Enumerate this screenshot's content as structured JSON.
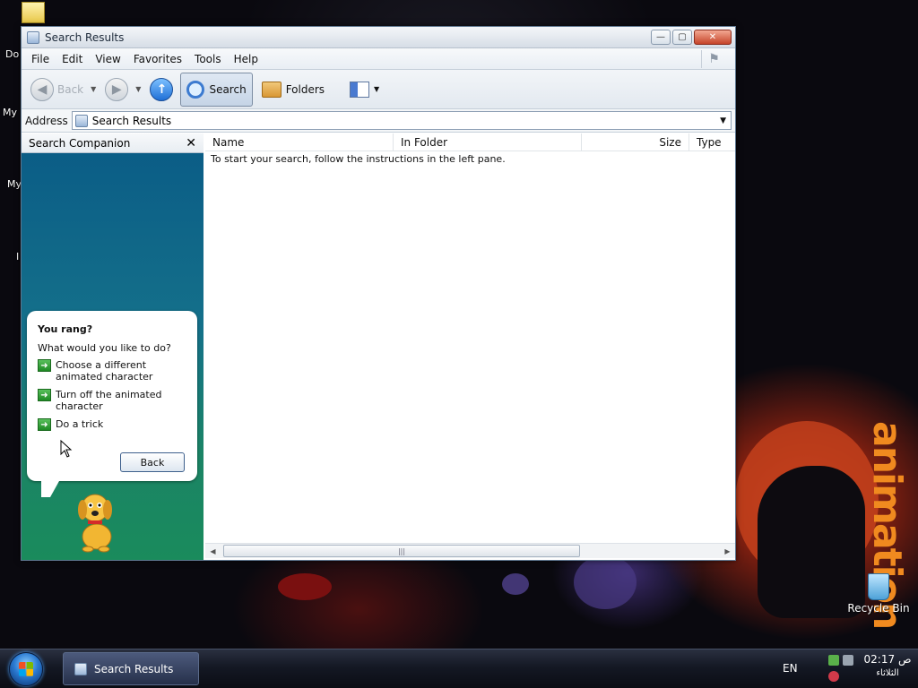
{
  "window": {
    "title": "Search Results",
    "controls": {
      "minimize": "—",
      "maximize": "▢",
      "close": "✕"
    }
  },
  "menubar": {
    "items": [
      "File",
      "Edit",
      "View",
      "Favorites",
      "Tools",
      "Help"
    ]
  },
  "toolbar": {
    "back_label": "Back",
    "search_label": "Search",
    "folders_label": "Folders"
  },
  "addressbar": {
    "label": "Address",
    "value": "Search Results"
  },
  "companion": {
    "header": "Search Companion",
    "balloon": {
      "title": "You rang?",
      "question": "What would you like to do?",
      "options": [
        "Choose a different animated character",
        "Turn off the animated character",
        "Do a trick"
      ],
      "back_label": "Back"
    }
  },
  "results": {
    "columns": [
      "Name",
      "In Folder",
      "Size",
      "Type"
    ],
    "empty_message": "To start your search, follow the instructions in the left pane."
  },
  "desktop": {
    "icons": [
      {
        "label": "Do"
      },
      {
        "label": "My"
      },
      {
        "label": "My"
      },
      {
        "label": "I"
      }
    ],
    "recycle_bin": "Recycle Bin",
    "art_text": "animation"
  },
  "taskbar": {
    "active_task": "Search Results",
    "language": "EN",
    "clock_time": "02:17 ص",
    "clock_day": "الثلاثاء"
  },
  "colors": {
    "accent": "#1f6fd6",
    "companion_top": "#0a5b86",
    "companion_bottom": "#1a8b5c",
    "art_orange": "#f08a1f"
  }
}
